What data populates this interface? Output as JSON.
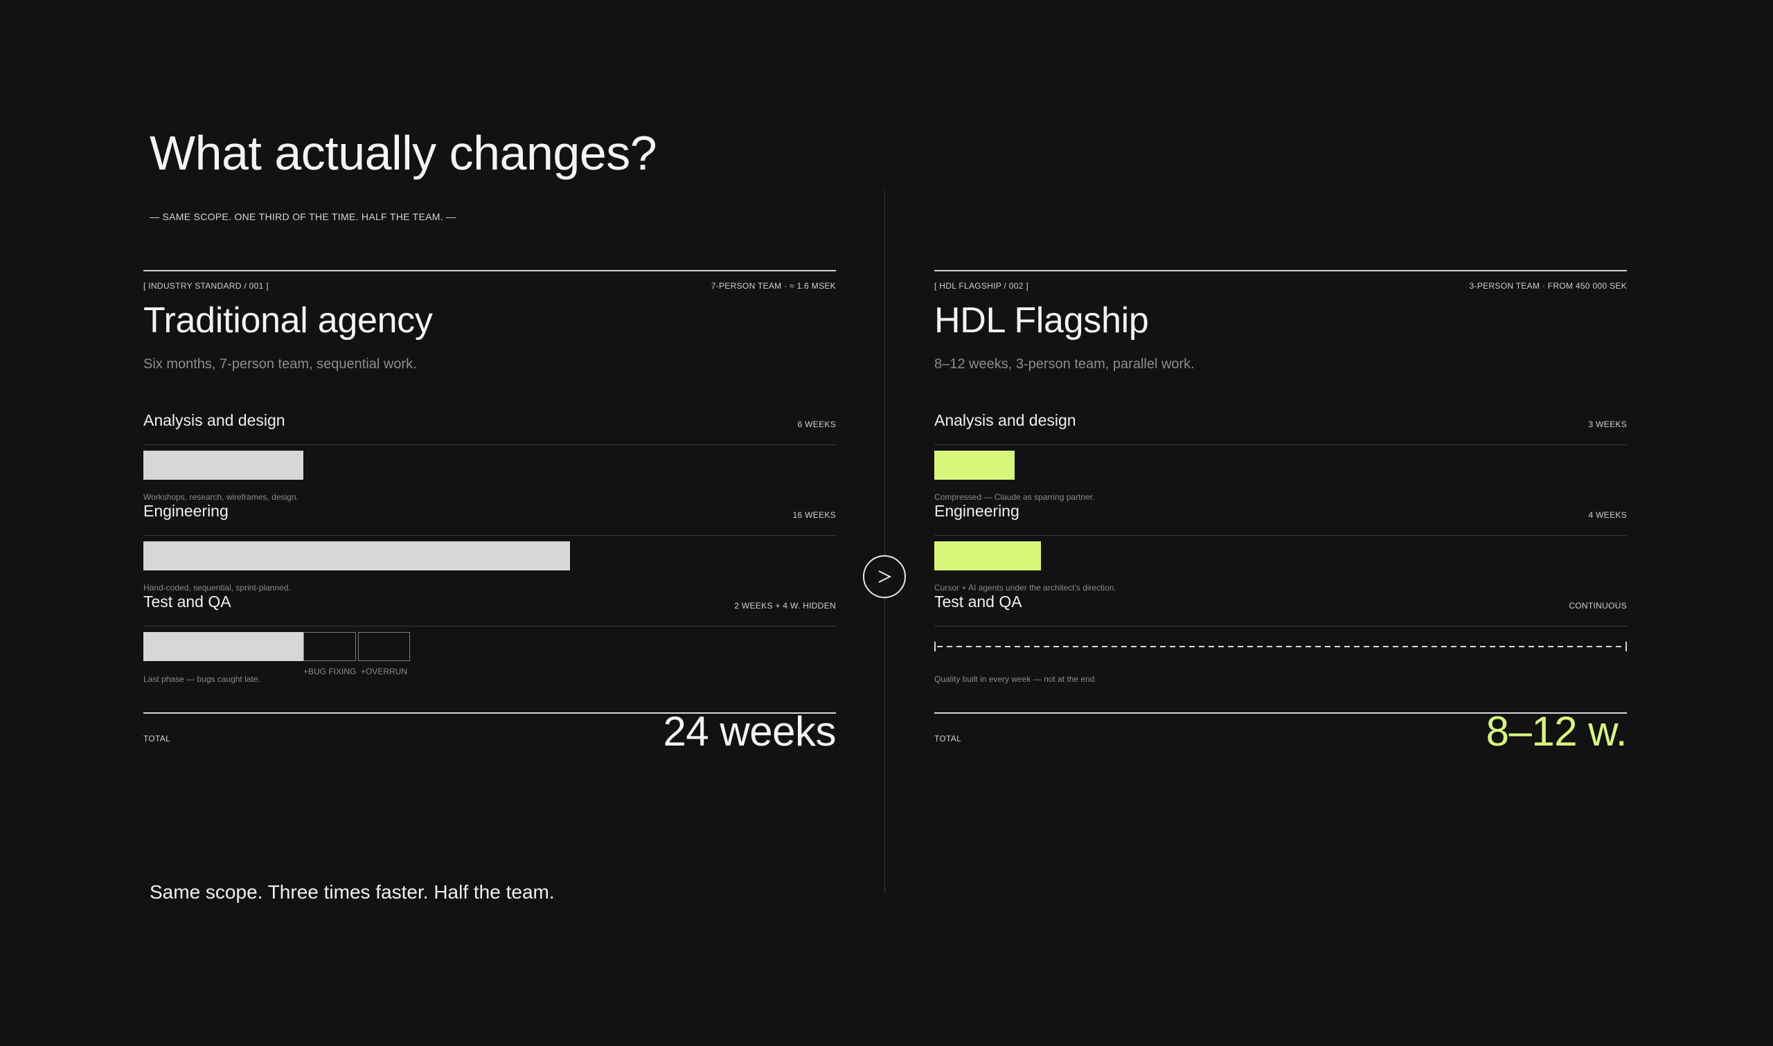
{
  "page": {
    "title": "What actually changes?",
    "subtitle": "— SAME SCOPE. ONE THIRD OF THE TIME. HALF THE TEAM. —",
    "footer": "Same scope. Three times faster. Half the team.",
    "arrow_icon": "chevron-right-icon"
  },
  "colors": {
    "background": "#121212",
    "accent": "#d8f77a",
    "grey_bar": "#d7d7d7"
  },
  "traditional": {
    "tag": "[ INDUSTRY STANDARD / 001 ]",
    "meta": "7-PERSON TEAM · ≈ 1.6 MSEK",
    "heading": "Traditional agency",
    "description": "Six months, 7-person team, sequential work.",
    "phases": [
      {
        "label": "Analysis and design",
        "duration": "6 WEEKS",
        "weeks": 6,
        "note": "Workshops, research, wireframes, design."
      },
      {
        "label": "Engineering",
        "duration": "16 WEEKS",
        "weeks": 16,
        "note": "Hand-coded, sequential, sprint-planned."
      },
      {
        "label": "Test and QA",
        "duration": "2 WEEKS + 4 W. HIDDEN",
        "weeks": 6,
        "note": "Last phase — bugs caught late.",
        "bug_fixing_label": "+BUG FIXING",
        "overrun_label": "+OVERRUN"
      }
    ],
    "total_label": "TOTAL",
    "total_value": "24 weeks"
  },
  "hdl": {
    "tag": "[ HDL FLAGSHIP / 002 ]",
    "meta": "3-PERSON TEAM · FROM 450 000 SEK",
    "heading": "HDL Flagship",
    "description": "8–12 weeks, 3-person team, parallel work.",
    "phases": [
      {
        "label": "Analysis and design",
        "duration": "3 WEEKS",
        "weeks": 3,
        "note": "Compressed — Claude as sparring partner."
      },
      {
        "label": "Engineering",
        "duration": "4 WEEKS",
        "weeks": 4,
        "note": "Cursor + AI agents under the architect's direction."
      },
      {
        "label": "Test and QA",
        "duration": "CONTINUOUS",
        "note": "Quality built in every week — not at the end."
      }
    ],
    "total_label": "TOTAL",
    "total_value": "8–12 w."
  }
}
